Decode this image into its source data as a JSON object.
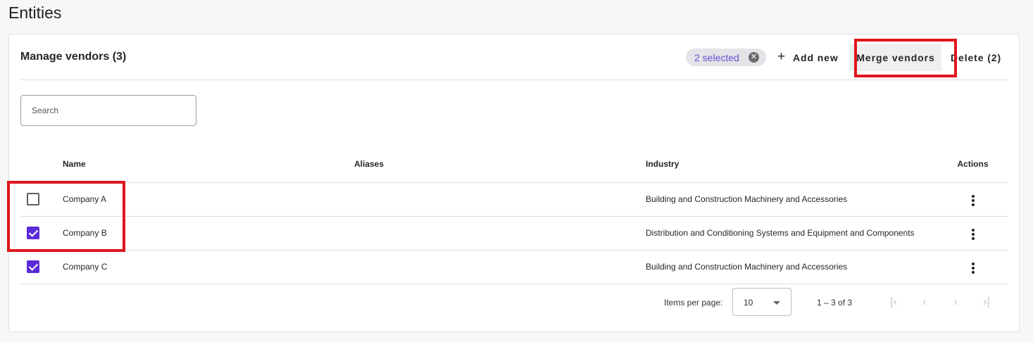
{
  "page": {
    "title": "Entities"
  },
  "card": {
    "title": "Manage vendors (3)",
    "selected_chip": "2 selected",
    "add_label": "Add new",
    "merge_label": "Merge vendors",
    "delete_label": "Delete (2)"
  },
  "search": {
    "placeholder": "Search",
    "value": ""
  },
  "table": {
    "columns": [
      "Name",
      "Aliases",
      "Industry",
      "Actions"
    ],
    "rows": [
      {
        "checked": false,
        "name": "Company A",
        "aliases": "",
        "industry": "Building and Construction Machinery and Accessories"
      },
      {
        "checked": true,
        "name": "Company B",
        "aliases": "",
        "industry": "Distribution and Conditioning Systems and Equipment and Components"
      },
      {
        "checked": true,
        "name": "Company C",
        "aliases": "",
        "industry": "Building and Construction Machinery and Accessories"
      }
    ]
  },
  "paginator": {
    "items_per_page_label": "Items per page:",
    "items_per_page_value": "10",
    "range_label": "1 – 3 of 3"
  },
  "colors": {
    "accent": "#5b2bd9",
    "chip_text": "#6a4fd6",
    "highlight": "#e0161e"
  },
  "icons": {
    "add": "plus-icon",
    "chip_close": "close-circle-icon",
    "row_action": "more-vertical-icon",
    "first": "first-page-icon",
    "prev": "chevron-left-icon",
    "next": "chevron-right-icon",
    "last": "last-page-icon"
  }
}
